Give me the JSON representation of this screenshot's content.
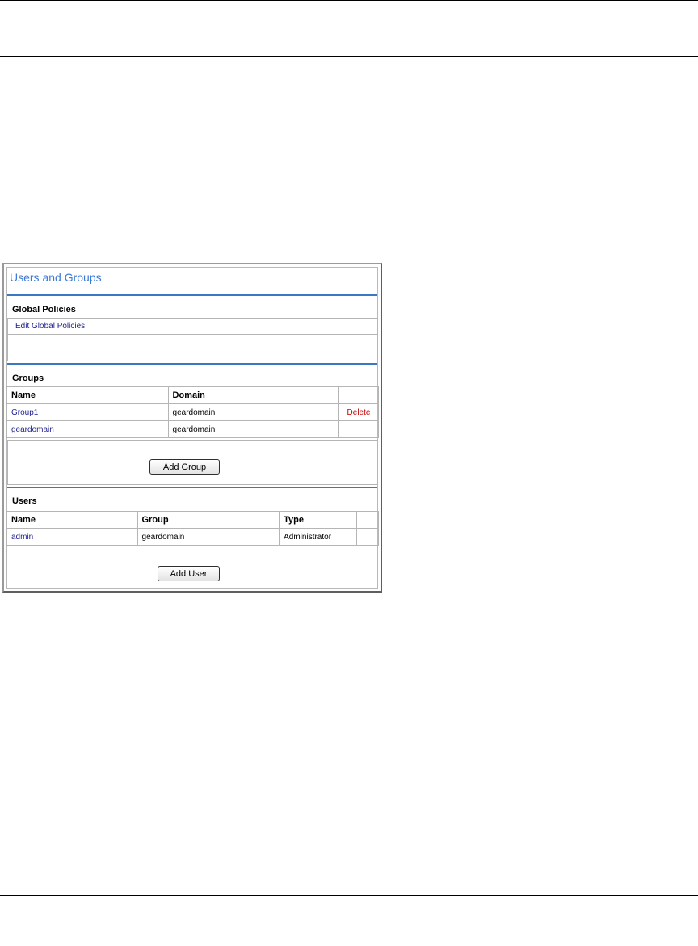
{
  "panel": {
    "title": "Users and Groups",
    "global_policies": {
      "heading": "Global Policies",
      "link": "Edit Global Policies"
    },
    "groups": {
      "heading": "Groups",
      "columns": [
        "Name",
        "Domain",
        ""
      ],
      "rows": [
        {
          "name": "Group1",
          "domain": "geardomain",
          "action": "Delete"
        },
        {
          "name": "geardomain",
          "domain": "geardomain",
          "action": ""
        }
      ],
      "add_button": "Add Group"
    },
    "users": {
      "heading": "Users",
      "columns": [
        "Name",
        "Group",
        "Type",
        ""
      ],
      "rows": [
        {
          "name": "admin",
          "group": "geardomain",
          "type": "Administrator"
        }
      ],
      "add_button": "Add User"
    },
    "colors": {
      "title": "#3d7bd6",
      "section_rule": "#3b78c4",
      "link": "#1f1f8f",
      "delete_link": "#c00000"
    }
  }
}
